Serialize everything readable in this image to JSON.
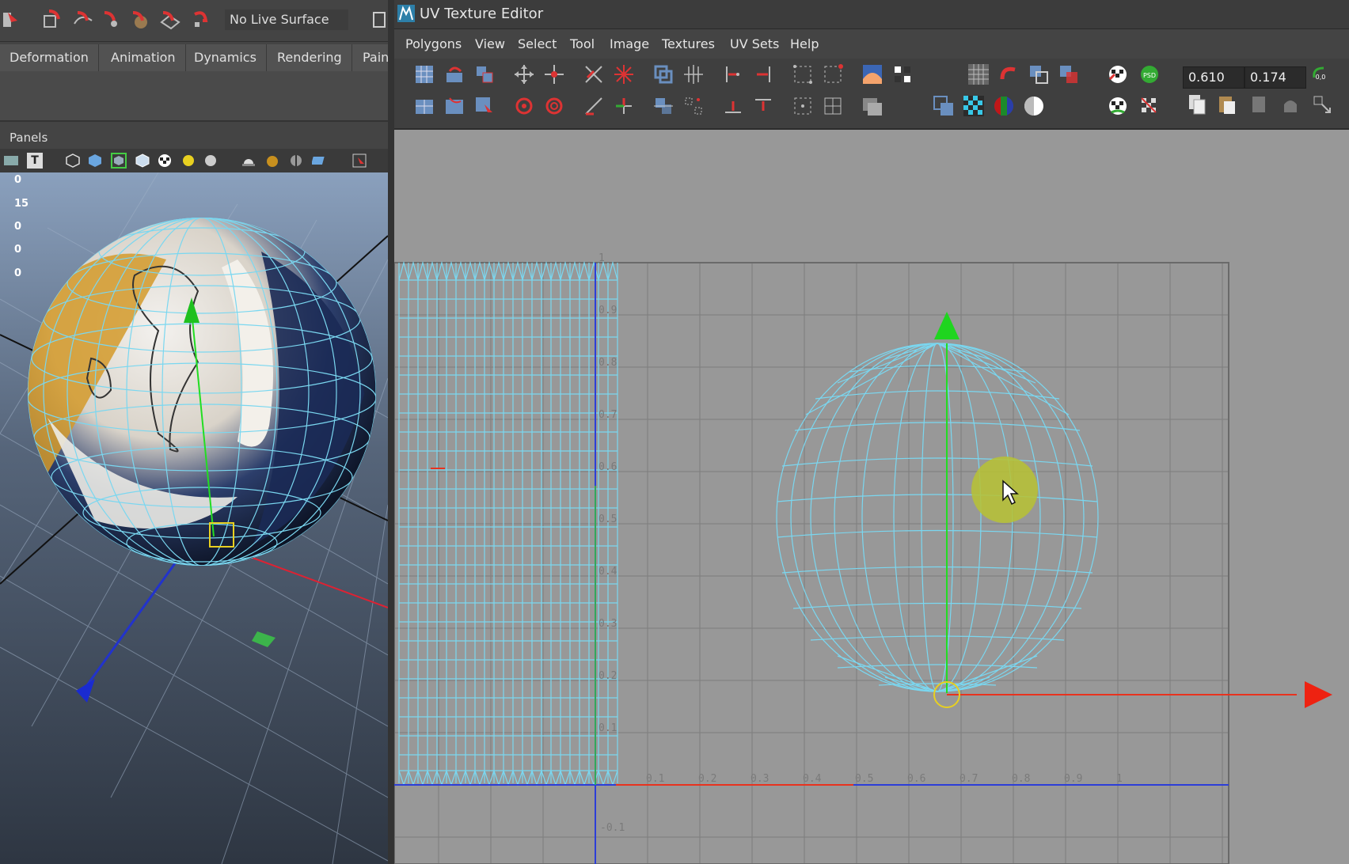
{
  "left_panel": {
    "live_surface_label": "No Live Surface",
    "shelf_tabs": [
      "Deformation",
      "Animation",
      "Dynamics",
      "Rendering",
      "Pain"
    ],
    "panels_label": "Panels",
    "hud_values": [
      "0",
      "15",
      "0",
      "0",
      "0"
    ],
    "text_tool_glyph": "T"
  },
  "uv_editor": {
    "title": "UV Texture Editor",
    "menu": [
      "Polygons",
      "View",
      "Select",
      "Tool",
      "Image",
      "Textures",
      "UV Sets",
      "Help"
    ],
    "coord_u": "0.610",
    "coord_v": "0.174",
    "psd_label": "PSD",
    "zero_label": "0,0",
    "grid_labels_u": [
      "0.1",
      "0.2",
      "0.3",
      "0.4",
      "0.5",
      "0.6",
      "0.7",
      "0.8",
      "0.9",
      "1"
    ],
    "grid_labels_v": [
      "0.9",
      "0.8",
      "0.7",
      "0.6",
      "0.5",
      "0.4",
      "0.3",
      "0.2",
      "0.1"
    ],
    "grid_label_top": "1",
    "grid_label_neg": "-0.1"
  },
  "colors": {
    "uv_wire": "#7ad7f0",
    "axis_u": "#e8321e",
    "axis_v": "#2c3ed8",
    "manip_green": "#22dd22",
    "manip_red": "#ee2211",
    "cursor_highlight": "#b7c233",
    "canvas_bg": "#989898"
  }
}
